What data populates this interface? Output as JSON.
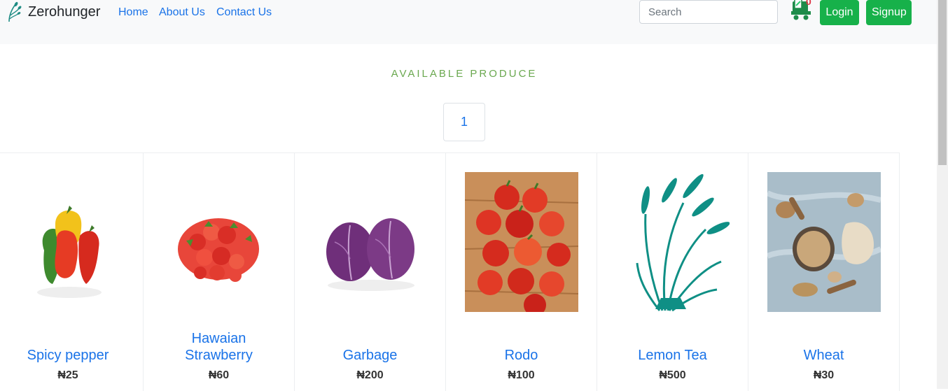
{
  "navbar": {
    "brand": "Zerohunger",
    "links": [
      "Home",
      "About Us",
      "Contact Us"
    ],
    "search_placeholder": "Search",
    "cart_count": "0",
    "login_label": "Login",
    "signup_label": "Signup",
    "accent_color": "#17b14a"
  },
  "main": {
    "section_title": "AVAILABLE PRODUCE",
    "pagination": {
      "current_page": "1"
    }
  },
  "products": [
    {
      "name": "Spicy pepper",
      "price": "₦25"
    },
    {
      "name": "Hawaian Strawberry",
      "price": "₦60"
    },
    {
      "name": "Garbage",
      "price": "₦200"
    },
    {
      "name": "Rodo",
      "price": "₦100"
    },
    {
      "name": "Lemon Tea",
      "price": "₦500"
    },
    {
      "name": "Wheat",
      "price": "₦30"
    }
  ]
}
